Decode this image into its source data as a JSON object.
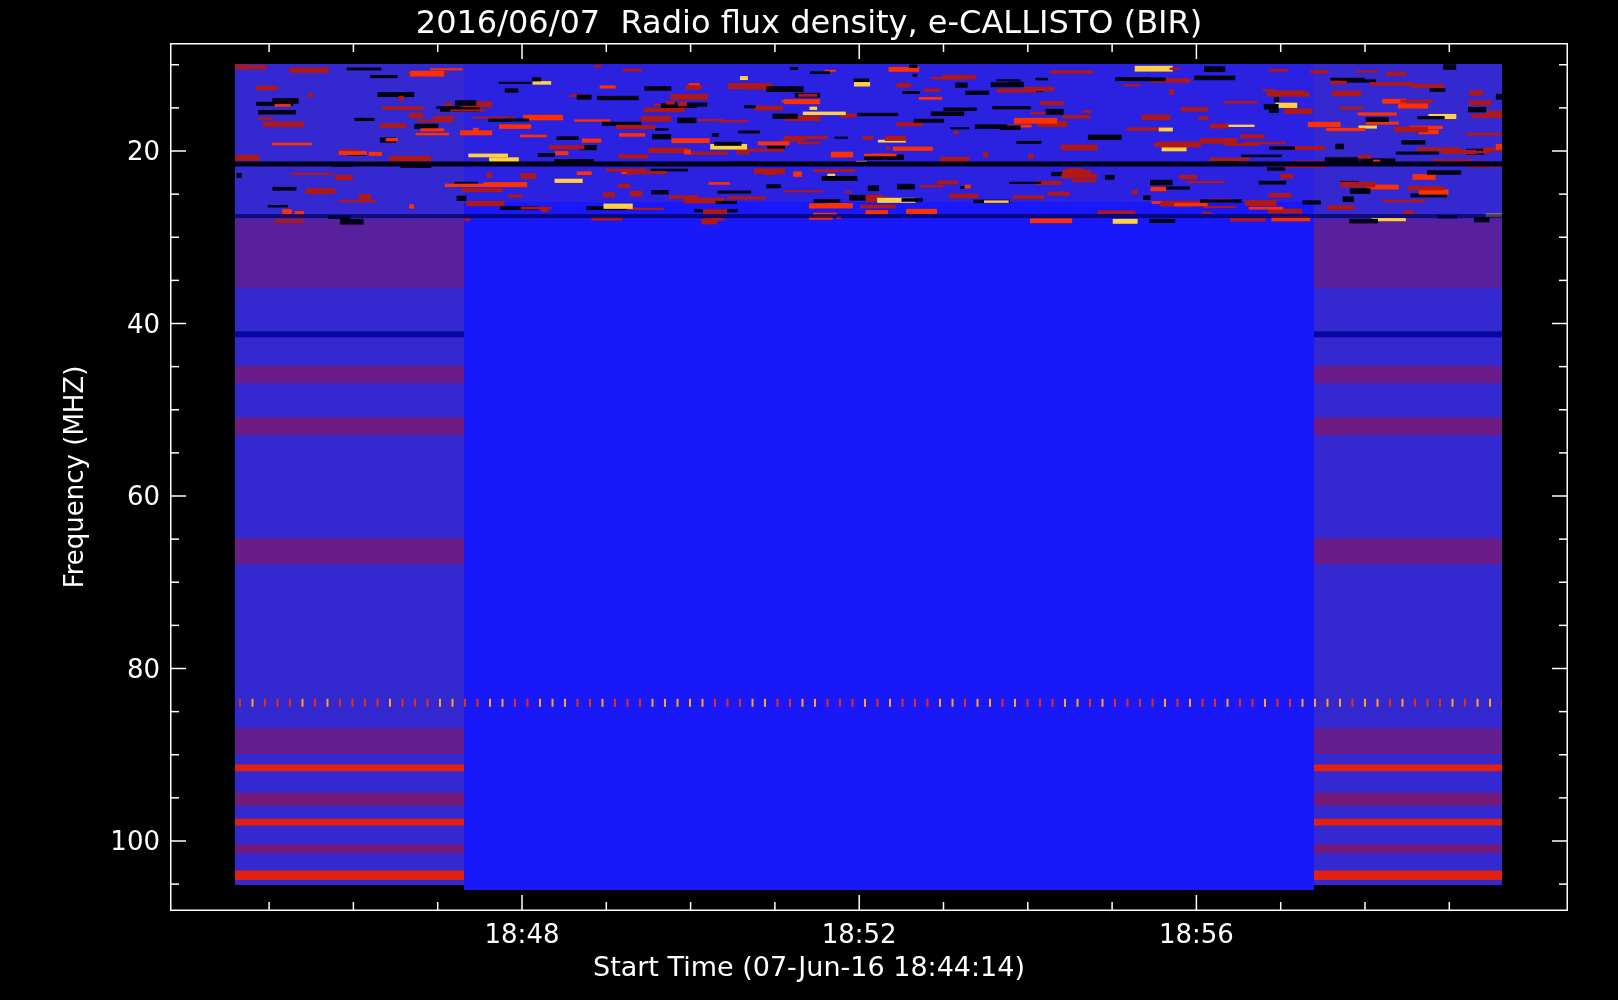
{
  "title": "2016/06/07  Radio flux density, e-CALLISTO (BIR)",
  "y_axis": {
    "label": "Frequency (MHZ)",
    "ticks": [
      "20",
      "40",
      "60",
      "80",
      "100"
    ]
  },
  "x_axis": {
    "label": "Start Time (07-Jun-16 18:44:14)",
    "ticks": [
      "18:48",
      "18:52",
      "18:56"
    ]
  }
}
